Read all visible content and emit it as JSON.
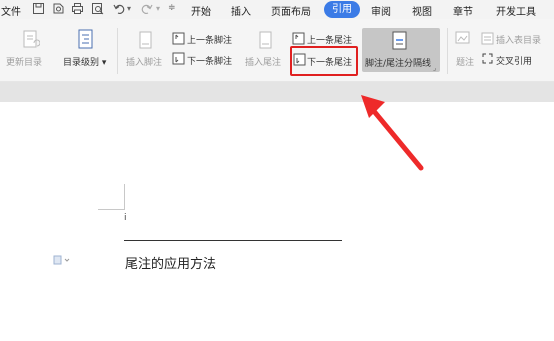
{
  "menu": {
    "file": "文件",
    "tabs": [
      "开始",
      "插入",
      "页面布局",
      "引用",
      "审阅",
      "视图",
      "章节",
      "开发工具"
    ],
    "active_tab": "引用"
  },
  "ribbon": {
    "update_toc": "更新目录",
    "toc_level": "目录级别",
    "insert_footnote": "插入脚注",
    "prev_footnote": "上一条脚注",
    "next_footnote": "下一条脚注",
    "insert_endnote": "插入尾注",
    "prev_endnote": "上一条尾注",
    "next_endnote": "下一条尾注",
    "separator_line": "脚注/尾注分隔线",
    "caption": "题注",
    "insert_toc_figures": "插入表目录",
    "cross_reference": "交叉引用"
  },
  "document": {
    "endnote_text": "尾注的应用方法",
    "endnote_ref": "i"
  },
  "colors": {
    "accent": "#3b7be6",
    "highlight_box": "#e02020",
    "arrow": "#ee2a2a"
  }
}
